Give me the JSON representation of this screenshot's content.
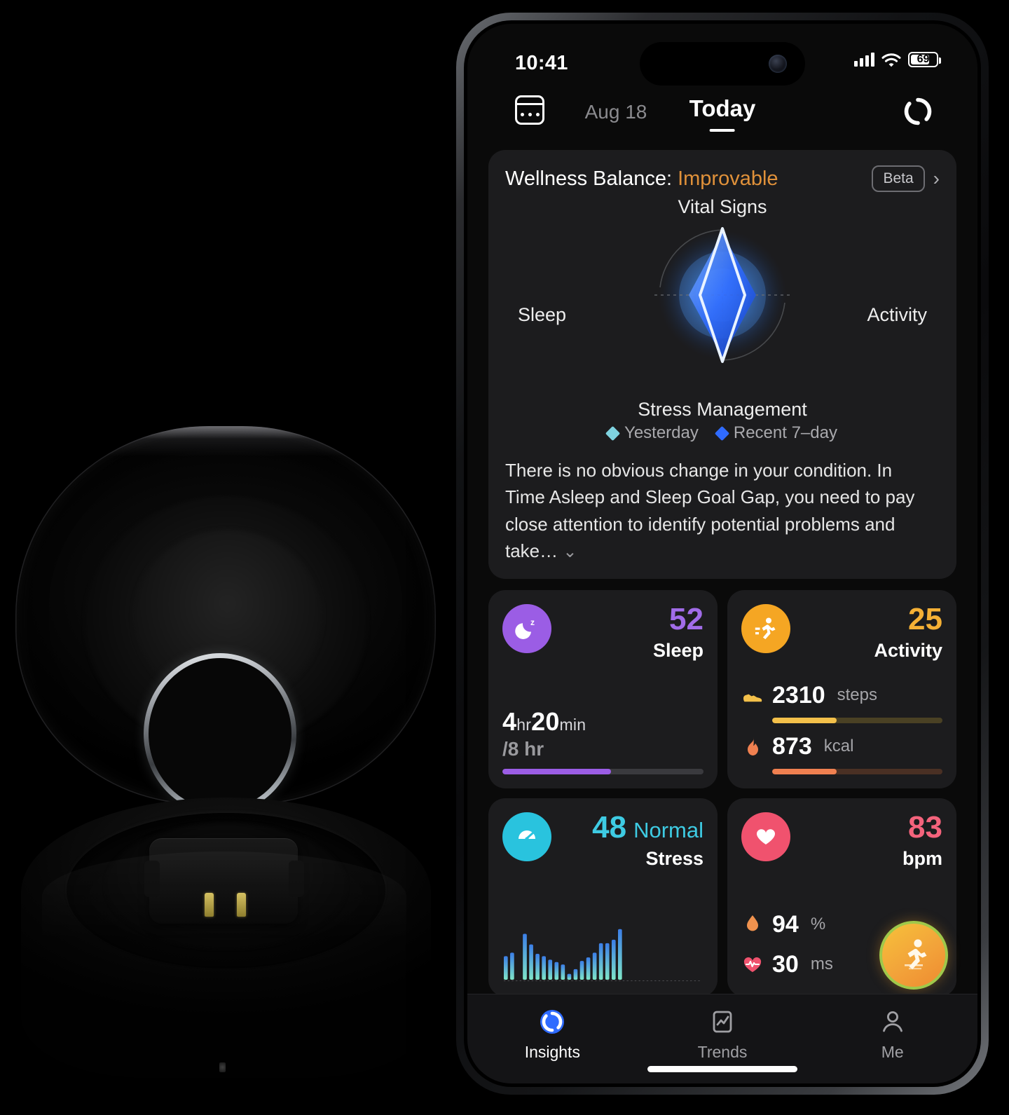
{
  "status_bar": {
    "time": "10:41",
    "battery_level": "69",
    "signal_icon": "cellular-bars-icon",
    "wifi_icon": "wifi-icon",
    "battery_icon": "battery-icon"
  },
  "nav": {
    "calendar_icon": "calendar-icon",
    "date": "Aug 18",
    "title": "Today",
    "sync_icon": "sync-ring-icon"
  },
  "wellness": {
    "title_prefix": "Wellness Balance: ",
    "status": "Improvable",
    "status_color": "#e0913a",
    "beta_label": "Beta",
    "chevron_right": "›",
    "axes": {
      "top": "Vital Signs",
      "left": "Sleep",
      "right": "Activity",
      "bottom": "Stress Management"
    },
    "legend": [
      {
        "label": "Yesterday",
        "color": "#7fd3e0"
      },
      {
        "label": "Recent 7–day",
        "color": "#2f6bff"
      }
    ],
    "summary": "There is no obvious change in your condition. In Time Asleep and Sleep Goal Gap, you need to pay close attention to identify potential problems and take…",
    "expand_chevron": "⌄"
  },
  "chart_data": {
    "type": "radar",
    "title": "Wellness Balance",
    "axes": [
      "Vital Signs",
      "Activity",
      "Stress Management",
      "Sleep"
    ],
    "range": [
      0,
      100
    ],
    "series": [
      {
        "name": "Yesterday",
        "color": "#7fd3e0",
        "values": [
          96,
          54,
          96,
          54
        ]
      },
      {
        "name": "Recent 7–day",
        "color": "#2f6bff",
        "values": [
          84,
          62,
          84,
          62
        ]
      }
    ],
    "legend_position": "bottom"
  },
  "metrics": [
    {
      "id": "sleep",
      "icon": "moon-sleep-icon",
      "icon_bg": "#9b5de5",
      "score": "52",
      "name": "Sleep",
      "score_color": "#a16ce8",
      "duration_hours": "4",
      "duration_hours_unit": "hr",
      "duration_minutes": "20",
      "duration_minutes_unit": "min",
      "goal": "/8 hr",
      "progress_percent": 54,
      "progress_color": "#9b5de5"
    },
    {
      "id": "activity",
      "icon": "running-person-icon",
      "icon_bg": "#f5a623",
      "score": "25",
      "name": "Activity",
      "score_color": "#f5b035",
      "stats": [
        {
          "icon": "shoe-icon",
          "value": "2310",
          "unit": "steps",
          "progress_percent": 38,
          "color": "#f3c04a"
        },
        {
          "icon": "flame-icon",
          "value": "873",
          "unit": "kcal",
          "progress_percent": 38,
          "color": "#f08050"
        }
      ]
    },
    {
      "id": "stress",
      "icon": "stress-gauge-icon",
      "icon_bg": "#29c3de",
      "score": "48",
      "score_word": "Normal",
      "name": "Stress",
      "score_color": "#3ecbe3",
      "spark_values": [
        40,
        46,
        0,
        78,
        60,
        44,
        40,
        34,
        30,
        26,
        10,
        18,
        32,
        38,
        46,
        62,
        62,
        68,
        86
      ]
    },
    {
      "id": "heart",
      "icon": "heart-icon",
      "icon_bg": "#f0526e",
      "score": "83",
      "name": "bpm",
      "score_color": "#f4637c",
      "stats": [
        {
          "icon": "blood-drop-icon",
          "value": "94",
          "unit": "%"
        },
        {
          "icon": "hrv-heart-icon",
          "value": "30",
          "unit": "ms"
        }
      ],
      "fab_icon": "workout-running-icon"
    }
  ],
  "tabbar": [
    {
      "icon": "insights-ring-icon",
      "label": "Insights",
      "active": true
    },
    {
      "icon": "trends-chart-icon",
      "label": "Trends",
      "active": false
    },
    {
      "icon": "person-icon",
      "label": "Me",
      "active": false
    }
  ]
}
